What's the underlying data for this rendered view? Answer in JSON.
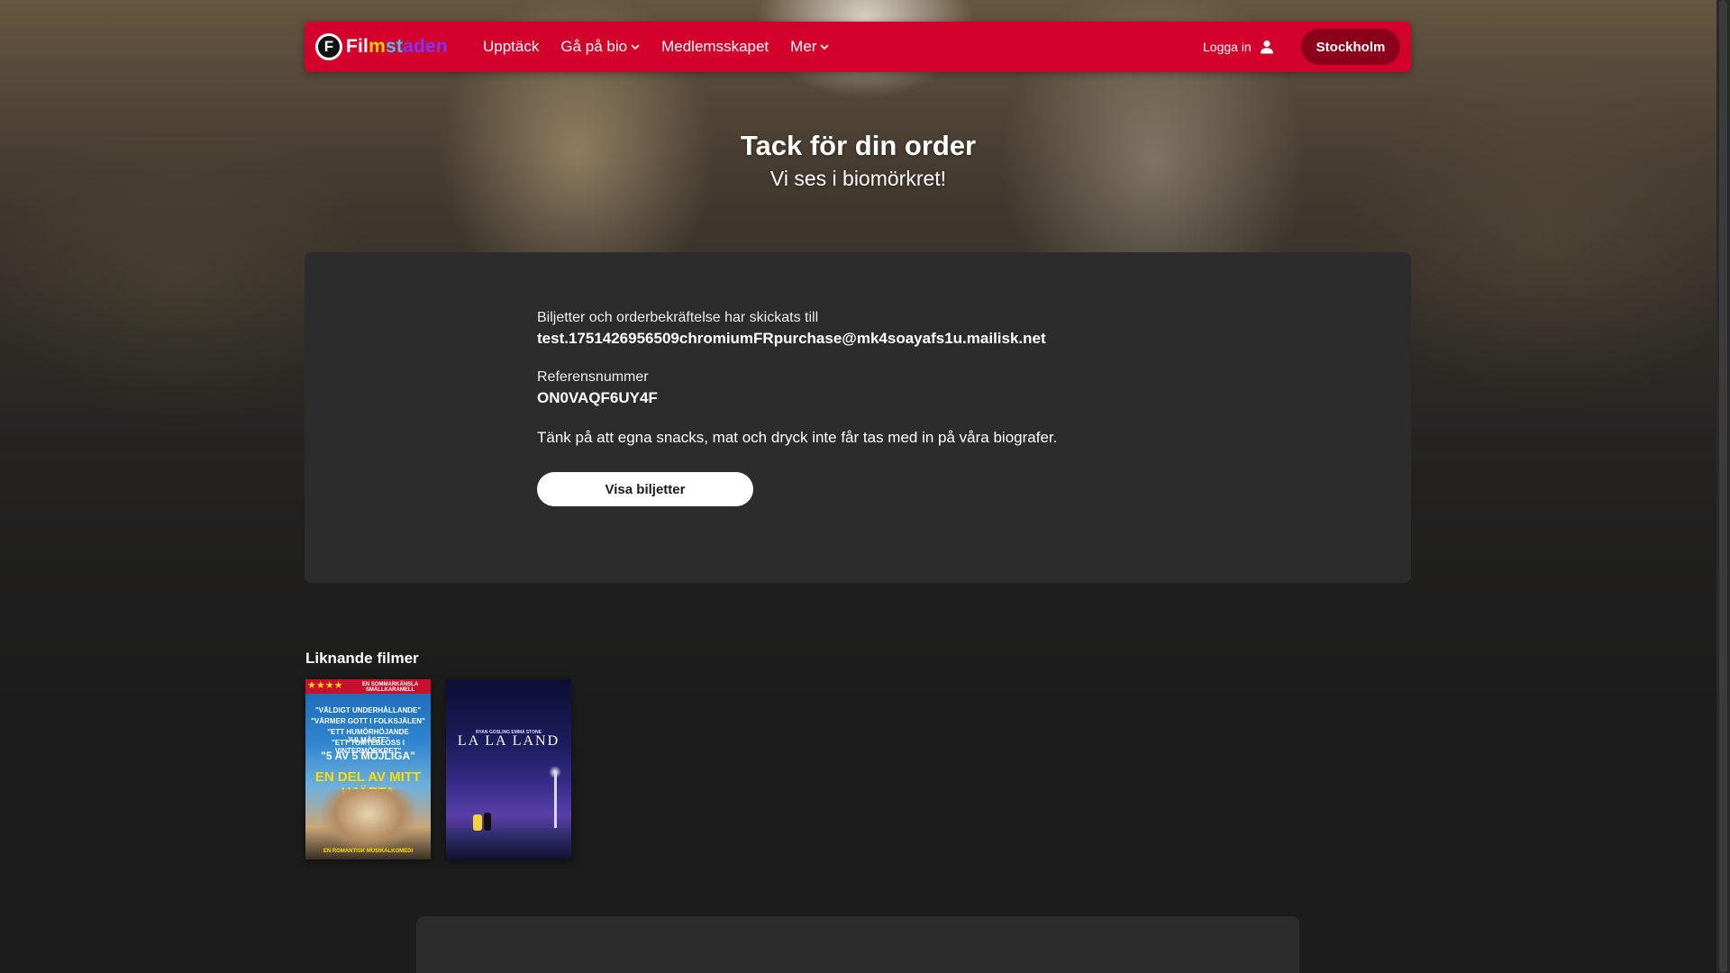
{
  "header": {
    "logo": {
      "mark": "F",
      "text_parts": [
        "Fil",
        "m",
        "st",
        "aden"
      ]
    },
    "nav": [
      {
        "label": "Upptäck",
        "has_dropdown": false
      },
      {
        "label": "Gå på bio",
        "has_dropdown": true
      },
      {
        "label": "Medlemsskapet",
        "has_dropdown": false
      },
      {
        "label": "Mer",
        "has_dropdown": true
      }
    ],
    "login_label": "Logga in",
    "city_button": "Stockholm"
  },
  "hero": {
    "title": "Tack för din order",
    "subtitle": "Vi ses i biomörkret!"
  },
  "order": {
    "sent_label": "Biljetter och orderbekräftelse har skickats till",
    "email": "test.1751426956509chromiumFRpurchase@mk4soayafs1u.mailisk.net",
    "reference_label": "Referensnummer",
    "reference_number": "ON0VAQF6UY4F",
    "snack_notice": "Tänk på att egna snacks, mat och dryck inte får tas med in på våra biografer.",
    "show_tickets_button": "Visa biljetter"
  },
  "similar": {
    "heading": "Liknande filmer",
    "movies": [
      {
        "name": "En del av mitt hjärta",
        "poster_stars": "★★★★",
        "poster_badge": "EN SOMMARKÄNSLA SMÄLLKARAMELL",
        "poster_quotes": [
          "\"VÄLDIGT UNDERHÅLLANDE\"",
          "\"VÄRMER GOTT I FOLKSJÄLEN\"",
          "\"ETT HUMÖRHÖJANDE JULMÅSTE\"",
          "\"ETT TOMTEBLOSS I VINTERMÖRKRET\""
        ],
        "poster_big_quote": "\"5 AV 5 MÖJLIGA\"",
        "poster_title": "EN DEL AV MITT HJÄRTA",
        "poster_tagline": "EN ROMANTISK MUSIKALKOMEDI"
      },
      {
        "name": "La La Land",
        "poster_title": "LA LA LAND",
        "poster_credits": "RYAN GOSLING  EMMA STONE"
      }
    ]
  },
  "colors": {
    "brand_red": "#d3002b",
    "city_button": "#8c0019",
    "panel": "#2c2c2c",
    "page_bg": "#1c1c1c"
  },
  "icons": {
    "user": "user-icon",
    "chevron": "chevron-down-icon"
  }
}
